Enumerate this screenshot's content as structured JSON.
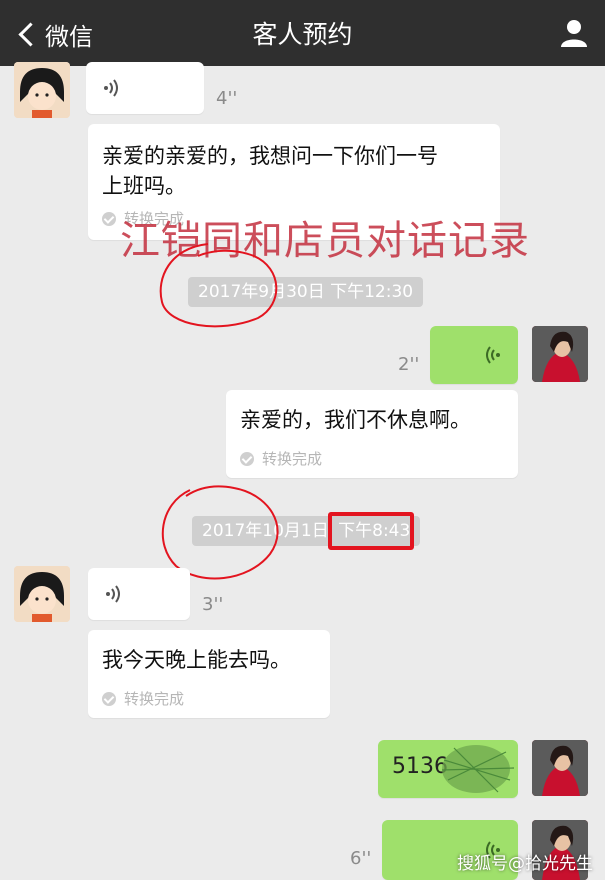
{
  "header": {
    "back_label": "微信",
    "title": "客人预约"
  },
  "messages": {
    "voice1_duration": "4''",
    "text1": "亲爱的亲爱的，我想问一下你们一号上班吗。",
    "text1_line1": "亲爱的亲爱的，我想问一下你们一号",
    "text1_line2": "上班吗。",
    "convert1": "转换完成",
    "time1": "2017年9月30日 下午12:30",
    "voice2_duration": "2''",
    "text2": "亲爱的，我们不休息啊。",
    "convert2": "转换完成",
    "time2_date": "2017年10月1日",
    "time2_time": "下午8:43",
    "voice3_duration": "3''",
    "text3": "我今天晚上能去吗。",
    "convert3": "转换完成",
    "partial_text": "5136",
    "voice4_duration": "6''"
  },
  "overlay": {
    "caption": "江铠同和店员对话记录",
    "watermark": "搜狐号@拾光先生"
  },
  "colors": {
    "header_bg": "#2f2f2f",
    "chat_bg": "#ebebeb",
    "green_bubble": "#9fe06b",
    "annotation_red": "#e3141f"
  }
}
